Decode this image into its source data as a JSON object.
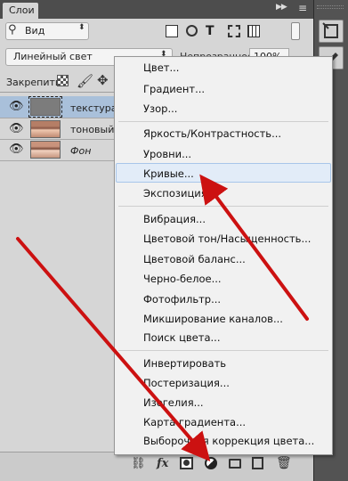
{
  "panel": {
    "tab_title": "Слои",
    "collapse_icon": "double-chevron-right-icon",
    "menu_icon": "panel-menu-icon"
  },
  "filter": {
    "kind_label": "Вид"
  },
  "blend": {
    "mode": "Линейный свет",
    "opacity_label": "Непрозрачность:",
    "opacity_value": "100%"
  },
  "lock": {
    "label": "Закрепить:"
  },
  "layers": [
    {
      "name": "текстура",
      "selected": true
    },
    {
      "name": "тоновый ри",
      "selected": false
    },
    {
      "name": "Фон",
      "selected": false
    }
  ],
  "bottom_bar": {
    "fx_label": "fx"
  },
  "menu": {
    "items": [
      "Цвет...",
      "Градиент...",
      "Узор...",
      "Яркость/Контрастность...",
      "Уровни...",
      "Кривые...",
      "Экспозиция...",
      "Вибрация...",
      "Цветовой тон/Насыщенность...",
      "Цветовой баланс...",
      "Черно-белое...",
      "Фотофильтр...",
      "Микширование каналов...",
      "Поиск цвета...",
      "Инвертировать",
      "Постеризация...",
      "Изогелия...",
      "Карта градиента...",
      "Выборочная коррекция цвета..."
    ],
    "highlighted": "Кривые..."
  },
  "colors": {
    "annotation_arrow": "#cc1111",
    "highlight": "#e2ecf8",
    "selected_layer": "#a9c0da"
  }
}
